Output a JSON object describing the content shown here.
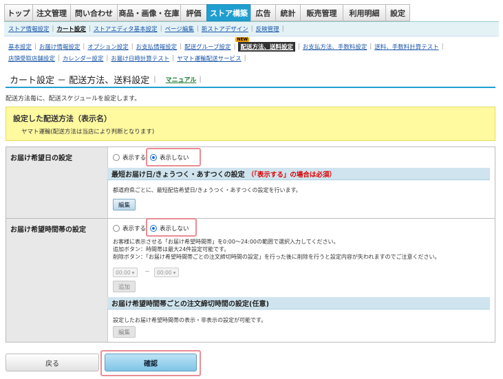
{
  "topnav": {
    "tabs": [
      {
        "label": "トップ",
        "w": 41
      },
      {
        "label": "注文管理",
        "w": 55
      },
      {
        "label": "問い合わせ",
        "w": 68
      },
      {
        "label": "商品・画像・在庫",
        "w": 92
      },
      {
        "label": "評価",
        "w": 38
      },
      {
        "label": "ストア構築",
        "w": 64,
        "active": true
      },
      {
        "label": "広告",
        "w": 36
      },
      {
        "label": "統計",
        "w": 36
      },
      {
        "label": "販売管理",
        "w": 62
      },
      {
        "label": "利用明細",
        "w": 62
      },
      {
        "label": "設定",
        "w": 36
      }
    ]
  },
  "subnav": {
    "items": [
      {
        "label": "ストア情報設定"
      },
      {
        "label": "カート設定",
        "current": true
      },
      {
        "label": "ストアエディタ基本設定"
      },
      {
        "label": "ページ編集"
      },
      {
        "label": "新ストアデザイン"
      },
      {
        "label": "反映管理"
      }
    ]
  },
  "cart_nav": {
    "row1": [
      {
        "label": "基本設定"
      },
      {
        "label": "お届け情報設定"
      },
      {
        "label": "オプション設定"
      },
      {
        "label": "お支払情報設定"
      },
      {
        "label": "配送グループ設定"
      },
      {
        "label": "配送方法、送料設定",
        "current": true
      },
      {
        "label": "お支払方法、手数料設定"
      },
      {
        "label": "送料、手数料計算テスト"
      }
    ],
    "row2": [
      {
        "label": "店頭受取店舗設定"
      },
      {
        "label": "カレンダー設定"
      },
      {
        "label": "お届け日時計算テスト"
      },
      {
        "label": "ヤマト運輸配送サービス"
      }
    ],
    "new_badge": "NEW"
  },
  "page": {
    "title": "カート設定 － 配送方法、送料設定",
    "manual_link": "マニュアル",
    "description": "配送方法毎に、配送スケジュールを設定します。"
  },
  "shipping_method": {
    "heading": "設定した配送方法（表示名）",
    "value": "ヤマト運輸(配送方法は当店により判断となります)"
  },
  "delivery_date": {
    "label": "お届け希望日の設定",
    "opt_show": "表示する",
    "opt_hide": "表示しない",
    "selected": "hide",
    "subheading": "最短お届け日/きょうつく・あすつくの設定",
    "subheading_note": "（「表示する」の場合は必須）",
    "help": "都道府県ごとに、最短配信希望日/きょうつく・あすつくの設定を行います。",
    "edit_button": "編集"
  },
  "delivery_time": {
    "label": "お届け希望時間帯の設定",
    "opt_show": "表示する",
    "opt_hide": "表示しない",
    "selected": "hide",
    "help1": "お客様に表示させる「お届け希望時間帯」を0:00～24:00の範囲で選択入力してください。",
    "help2": "追加ボタン：時間帯は最大24件設定可能です。",
    "help3": "削除ボタン：「お届け希望時間帯ごとの注文締切時間の設定」を行った後に削除を行うと設定内容が失われますのでご注意ください。",
    "from_value": "00:00",
    "to_value": "00:00",
    "range_sep": "－",
    "add_button": "追加",
    "subheading": "お届け希望時間帯ごとの注文締切時間の設定(任意)",
    "help4": "設定したお届け希望時間帯の表示・非表示の設定が可能です。",
    "edit_button": "編集"
  },
  "footer": {
    "back_button": "戻る",
    "confirm_button": "確認"
  },
  "colors": {
    "accent": "#1f9fd0",
    "highlight": "#e98b93",
    "notice_bg": "#fff9a0"
  }
}
